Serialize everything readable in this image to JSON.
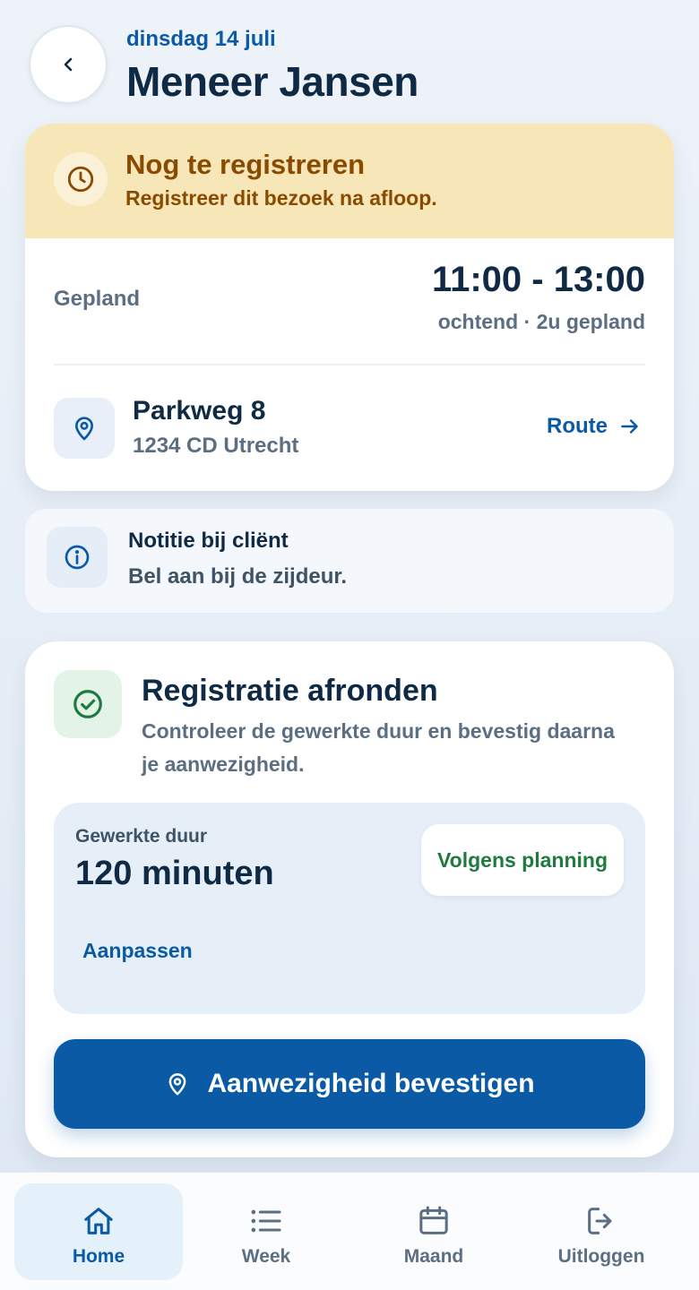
{
  "header": {
    "date": "dinsdag 14 juli",
    "title": "Meneer Jansen"
  },
  "status_alert": {
    "title": "Nog te registreren",
    "subtitle": "Registreer dit bezoek na afloop.",
    "icon": "clock-icon"
  },
  "visit": {
    "planned_label": "Gepland",
    "time_range": "11:00 - 13:00",
    "time_sub": "ochtend · 2u gepland",
    "address_street": "Parkweg 8",
    "address_city": "1234 CD Utrecht",
    "route_label": "Route"
  },
  "note": {
    "title": "Notitie bij cliënt",
    "text": "Bel aan bij de zijdeur."
  },
  "registration": {
    "title": "Registratie afronden",
    "description": "Controleer de gewerkte duur en bevestig daarna je aanwezigheid.",
    "duration_label": "Gewerkte duur",
    "duration_value": "120 minuten",
    "plan_badge": "Volgens planning",
    "adjust_label": "Aanpassen",
    "confirm_label": "Aanwezigheid bevestigen"
  },
  "nav": {
    "items": [
      {
        "label": "Home",
        "icon": "home-icon",
        "active": true
      },
      {
        "label": "Week",
        "icon": "list-icon",
        "active": false
      },
      {
        "label": "Maand",
        "icon": "calendar-icon",
        "active": false
      },
      {
        "label": "Uitloggen",
        "icon": "logout-icon",
        "active": false
      }
    ]
  },
  "colors": {
    "accent": "#0b5aa6",
    "alert_bg": "#f7e6b7",
    "alert_text": "#8a4a00",
    "success": "#1f7a3e"
  }
}
